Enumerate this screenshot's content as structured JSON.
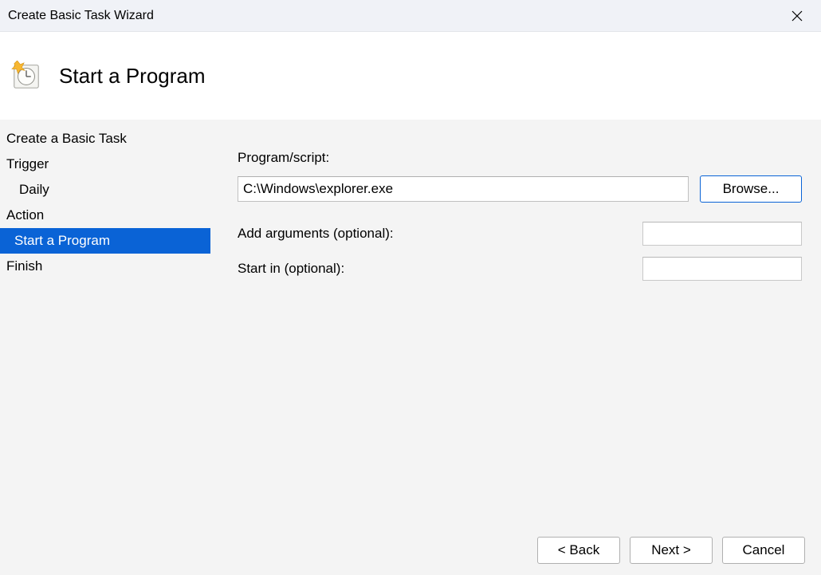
{
  "window": {
    "title": "Create Basic Task Wizard"
  },
  "header": {
    "title": "Start a Program"
  },
  "sidebar": {
    "items": [
      {
        "label": "Create a Basic Task",
        "type": "top",
        "selected": false
      },
      {
        "label": "Trigger",
        "type": "top",
        "selected": false
      },
      {
        "label": "Daily",
        "type": "sub",
        "selected": false
      },
      {
        "label": "Action",
        "type": "top",
        "selected": false
      },
      {
        "label": "Start a Program",
        "type": "sub",
        "selected": true
      },
      {
        "label": "Finish",
        "type": "top",
        "selected": false
      }
    ]
  },
  "form": {
    "program_label": "Program/script:",
    "program_value": "C:\\Windows\\explorer.exe",
    "browse_label": "Browse...",
    "args_label": "Add arguments (optional):",
    "args_value": "",
    "startin_label": "Start in (optional):",
    "startin_value": ""
  },
  "footer": {
    "back": "< Back",
    "next": "Next >",
    "cancel": "Cancel"
  }
}
